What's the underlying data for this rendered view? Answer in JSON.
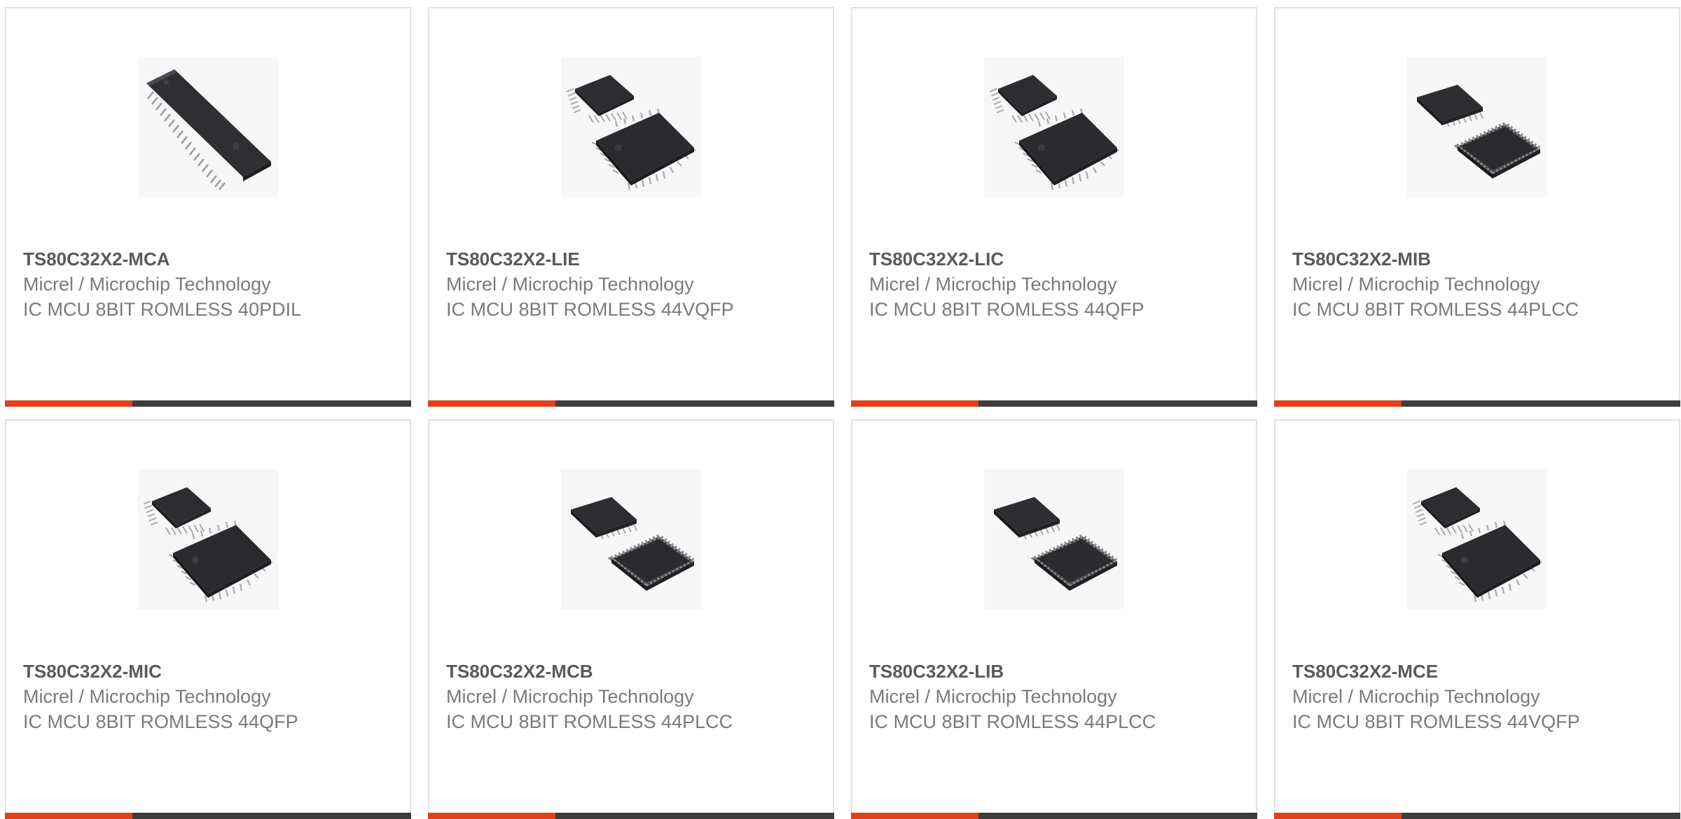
{
  "colors": {
    "accent": "#e0401a",
    "bar": "#3d3d3d",
    "card_border": "#e2e2e2",
    "title_text": "#5a5a5a",
    "body_text": "#7a7a7a"
  },
  "products": [
    {
      "part_number": "TS80C32X2-MCA",
      "manufacturer": "Micrel / Microchip Technology",
      "description": "IC MCU 8BIT ROMLESS 40PDIL",
      "image_icon": "dip-ic-chip-icon"
    },
    {
      "part_number": "TS80C32X2-LIE",
      "manufacturer": "Micrel / Microchip Technology",
      "description": "IC MCU 8BIT ROMLESS 44VQFP",
      "image_icon": "qfp-chips-icon"
    },
    {
      "part_number": "TS80C32X2-LIC",
      "manufacturer": "Micrel / Microchip Technology",
      "description": "IC MCU 8BIT ROMLESS 44QFP",
      "image_icon": "qfp-chips-icon"
    },
    {
      "part_number": "TS80C32X2-MIB",
      "manufacturer": "Micrel / Microchip Technology",
      "description": "IC MCU 8BIT ROMLESS 44PLCC",
      "image_icon": "plcc-chips-icon"
    },
    {
      "part_number": "TS80C32X2-MIC",
      "manufacturer": "Micrel / Microchip Technology",
      "description": "IC MCU 8BIT ROMLESS 44QFP",
      "image_icon": "qfp-chips-icon"
    },
    {
      "part_number": "TS80C32X2-MCB",
      "manufacturer": "Micrel / Microchip Technology",
      "description": "IC MCU 8BIT ROMLESS 44PLCC",
      "image_icon": "plcc-chips-icon"
    },
    {
      "part_number": "TS80C32X2-LIB",
      "manufacturer": "Micrel / Microchip Technology",
      "description": "IC MCU 8BIT ROMLESS 44PLCC",
      "image_icon": "plcc-chips-icon"
    },
    {
      "part_number": "TS80C32X2-MCE",
      "manufacturer": "Micrel / Microchip Technology",
      "description": "IC MCU 8BIT ROMLESS 44VQFP",
      "image_icon": "qfp-chips-icon"
    }
  ]
}
